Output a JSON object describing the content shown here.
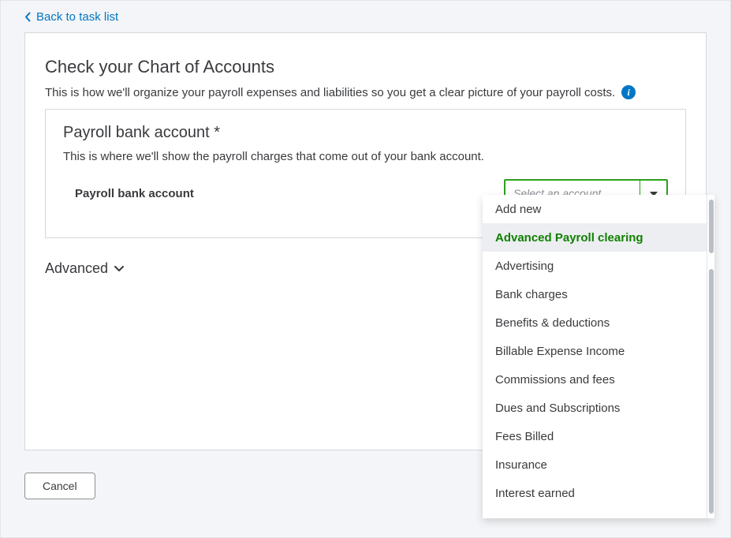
{
  "back_link_text": "Back to task list",
  "page": {
    "title": "Check your Chart of Accounts",
    "subtitle": "This is how we'll organize your payroll expenses and liabilities so you get a clear picture of your payroll costs."
  },
  "section": {
    "title": "Payroll bank account *",
    "description": "This is where we'll show the payroll charges that come out of your bank account.",
    "field_label": "Payroll bank account",
    "select_placeholder": "Select an account"
  },
  "advanced_label": "Advanced",
  "cancel_label": "Cancel",
  "dropdown": {
    "options": [
      {
        "label": "Add new",
        "highlight": false
      },
      {
        "label": "Advanced Payroll clearing",
        "highlight": true
      },
      {
        "label": "Advertising",
        "highlight": false
      },
      {
        "label": "Bank charges",
        "highlight": false
      },
      {
        "label": "Benefits & deductions",
        "highlight": false
      },
      {
        "label": "Billable Expense Income",
        "highlight": false
      },
      {
        "label": "Commissions and fees",
        "highlight": false
      },
      {
        "label": "Dues and Subscriptions",
        "highlight": false
      },
      {
        "label": "Fees Billed",
        "highlight": false
      },
      {
        "label": "Insurance",
        "highlight": false
      },
      {
        "label": "Interest earned",
        "highlight": false
      }
    ]
  },
  "colors": {
    "link": "#0077c5",
    "accent_green": "#2ca01c",
    "highlight_green": "#108000",
    "text": "#393a3d"
  }
}
